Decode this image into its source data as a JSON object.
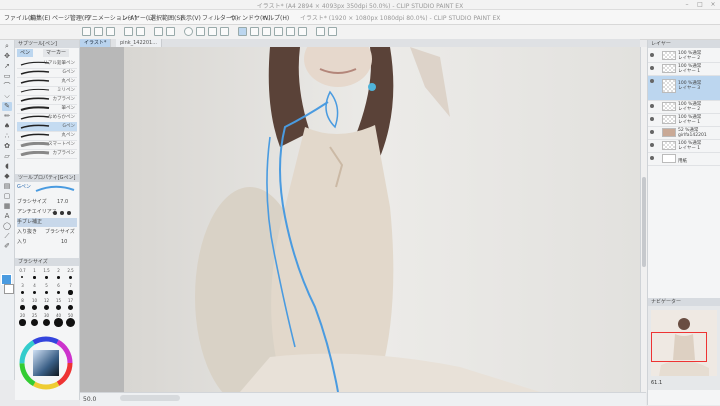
{
  "app": {
    "title": "イラスト* (1920 × 1080px 1080dpi 80.0%) - CLIP STUDIO PAINT EX",
    "sub_title": "イラスト* (A4 2894 × 4093px 350dpi 50.0%) - CLIP STUDIO PAINT EX"
  },
  "menu": [
    "ファイル(F)",
    "編集(E)",
    "ページ管理(P)",
    "アニメーション(A)",
    "レイヤー(L)",
    "選択範囲(S)",
    "表示(V)",
    "フィルター(I)",
    "ウィンドウ(W)",
    "ヘルプ(H)"
  ],
  "doc_tabs": [
    {
      "label": "イラスト*",
      "active": true
    },
    {
      "label": "pink_142201...",
      "active": false
    }
  ],
  "sub_tool": {
    "header": "サブツール[ペン]",
    "groups": [
      "ペン",
      "マーカー"
    ],
    "brushes": [
      {
        "label": "リアル鉛筆ペン",
        "selected": false
      },
      {
        "label": "Gペン",
        "selected": false
      },
      {
        "label": "丸ペン",
        "selected": false
      },
      {
        "label": "ミリペン",
        "selected": false
      },
      {
        "label": "カブラペン",
        "selected": false
      },
      {
        "label": "筆ペン",
        "selected": false
      },
      {
        "label": "なめらかペン",
        "selected": false
      },
      {
        "label": "Gペン",
        "selected": true
      },
      {
        "label": "丸ペン",
        "selected": false
      },
      {
        "label": "スマートペン",
        "selected": false
      },
      {
        "label": "カブラペン",
        "selected": false
      }
    ]
  },
  "tool_property": {
    "header": "ツールプロパティ[Gペン]",
    "tool_name": "Gペン",
    "brush_size_label": "ブラシサイズ",
    "brush_size_value": "17.0",
    "antialias_label": "アンチエイリアス",
    "stabilization_label": "手ブレ補正",
    "stabilization_value": "",
    "stroke_in_label": "入り抜き",
    "stroke_in_value": "ブラシサイズ",
    "in_label": "入り",
    "in_value": "10"
  },
  "brush_size_palette": {
    "header": "ブラシサイズ",
    "values": [
      "0.7",
      "1",
      "1.5",
      "2",
      "2.5",
      "3",
      "4",
      "5",
      "6",
      "7",
      "8",
      "10",
      "12",
      "15",
      "17",
      "20",
      "25",
      "30",
      "40",
      "50"
    ]
  },
  "layers": {
    "header": "レイヤー",
    "items": [
      {
        "line1": "100 %通常",
        "line2": "レイヤー 2",
        "selected": false
      },
      {
        "line1": "100 %通常",
        "line2": "レイヤー 1",
        "selected": false
      },
      {
        "line1": "100 %通常",
        "line2": "レイヤー 3",
        "selected": true
      },
      {
        "line1": "100 %通常",
        "line2": "レイヤー 2",
        "selected": false
      },
      {
        "line1": "100 %通常",
        "line2": "レイヤー 1",
        "selected": false
      },
      {
        "line1": "52 %通常",
        "line2": "girlfa142201",
        "selected": false
      },
      {
        "line1": "100 %通常",
        "line2": "レイヤー 1",
        "selected": false
      },
      {
        "line1": "",
        "line2": "用紙",
        "selected": false
      }
    ]
  },
  "navigator": {
    "header": "ナビゲーター",
    "zoom": "61.1"
  },
  "status": {
    "zoom": "50.0"
  },
  "colors": {
    "accent": "#bcd6ef",
    "stroke": "#4a9be0"
  }
}
